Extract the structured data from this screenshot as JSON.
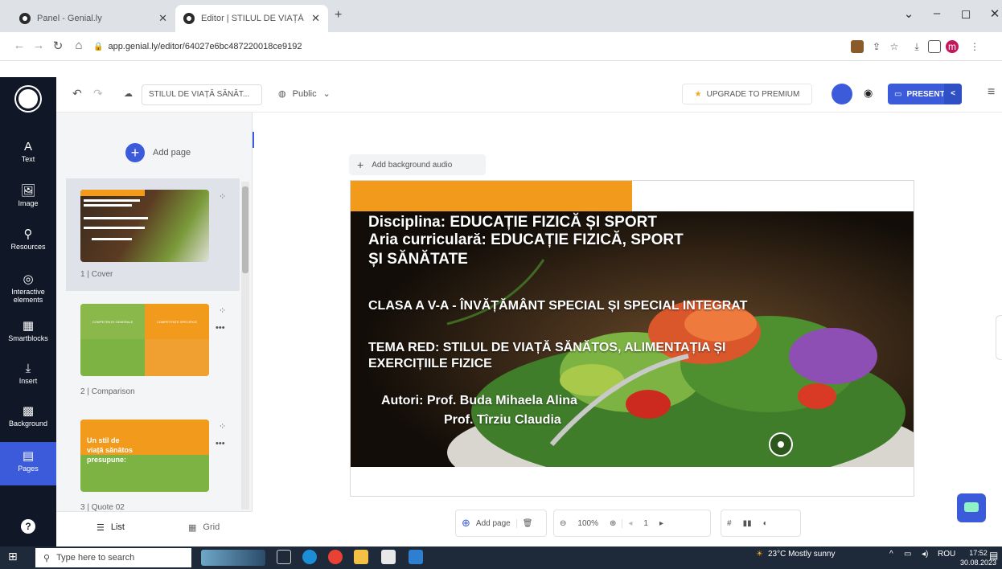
{
  "browser": {
    "tabs": [
      {
        "title": "Panel - Genial.ly",
        "active": false
      },
      {
        "title": "Editor | STILUL DE VIAȚĂ SĂNĂT",
        "active": true
      }
    ],
    "new_tab": "+",
    "url": "app.genial.ly/editor/64027e6bc487220018ce9192",
    "window_controls": {
      "minimize": "–",
      "maximize": "◻",
      "close": "✕",
      "dropdown": "⌄"
    },
    "profile_initial": "m"
  },
  "rail": {
    "items": [
      {
        "label": "Text",
        "icon": "A"
      },
      {
        "label": "Image",
        "icon": "🖼"
      },
      {
        "label": "Resources",
        "icon": "⚲"
      },
      {
        "label": "Interactive elements",
        "icon": "◎"
      },
      {
        "label": "Smartblocks",
        "icon": "▦"
      },
      {
        "label": "Insert",
        "icon": "⤓"
      },
      {
        "label": "Background",
        "icon": "▩"
      },
      {
        "label": "Pages",
        "icon": "▤"
      }
    ],
    "help": "?"
  },
  "header": {
    "doc_title": "STILUL DE VIAȚĂ SĂNĂT...",
    "visibility": "Public",
    "upgrade": "UPGRADE TO PREMIUM",
    "present": "PRESENT"
  },
  "pages_panel": {
    "add_page": "Add page",
    "pages": [
      {
        "label": "1 | Cover"
      },
      {
        "label": "2 | Comparison"
      },
      {
        "label": "3 | Quote 02"
      }
    ],
    "thumb2_texts": [
      "COMPETENȚE GENERALE",
      "COMPETENȚE SPECIFICE"
    ],
    "thumb3_text": "Un stil de viață sănătos presupune:",
    "view_list": "List",
    "view_grid": "Grid"
  },
  "canvas": {
    "add_background_audio": "Add background audio",
    "slide": {
      "line1": "Disciplina: EDUCAȚIE FIZICĂ ȘI SPORT",
      "line2": "Aria curriculară: EDUCAȚIE FIZICĂ, SPORT",
      "line3": "ȘI SĂNĂTATE",
      "line4": "CLASA A V-A  - ÎNVĂȚĂMÂNT SPECIAL ȘI SPECIAL INTEGRAT",
      "line5": "TEMA RED: STILUL DE VIAȚĂ SĂNĂTOS, ALIMENTAȚIA ȘI",
      "line6": "EXERCIȚIILE FIZICE",
      "line7": "Autori:  Prof. Buda Mihaela Alina",
      "line8": "Prof. Tîrziu Claudia"
    }
  },
  "bottom_toolbar": {
    "add_page": "Add page",
    "zoom": "100%",
    "page_number": "1"
  },
  "taskbar": {
    "search_placeholder": "Type here to search",
    "weather": "23°C  Mostly sunny",
    "language": "ROU",
    "time": "17:52",
    "date": "30.08.2023"
  },
  "colors": {
    "accent": "#3b5bdb",
    "slide_orange": "#f29a1c",
    "thumb_green": "#7cb342",
    "rail_bg": "#101828"
  }
}
